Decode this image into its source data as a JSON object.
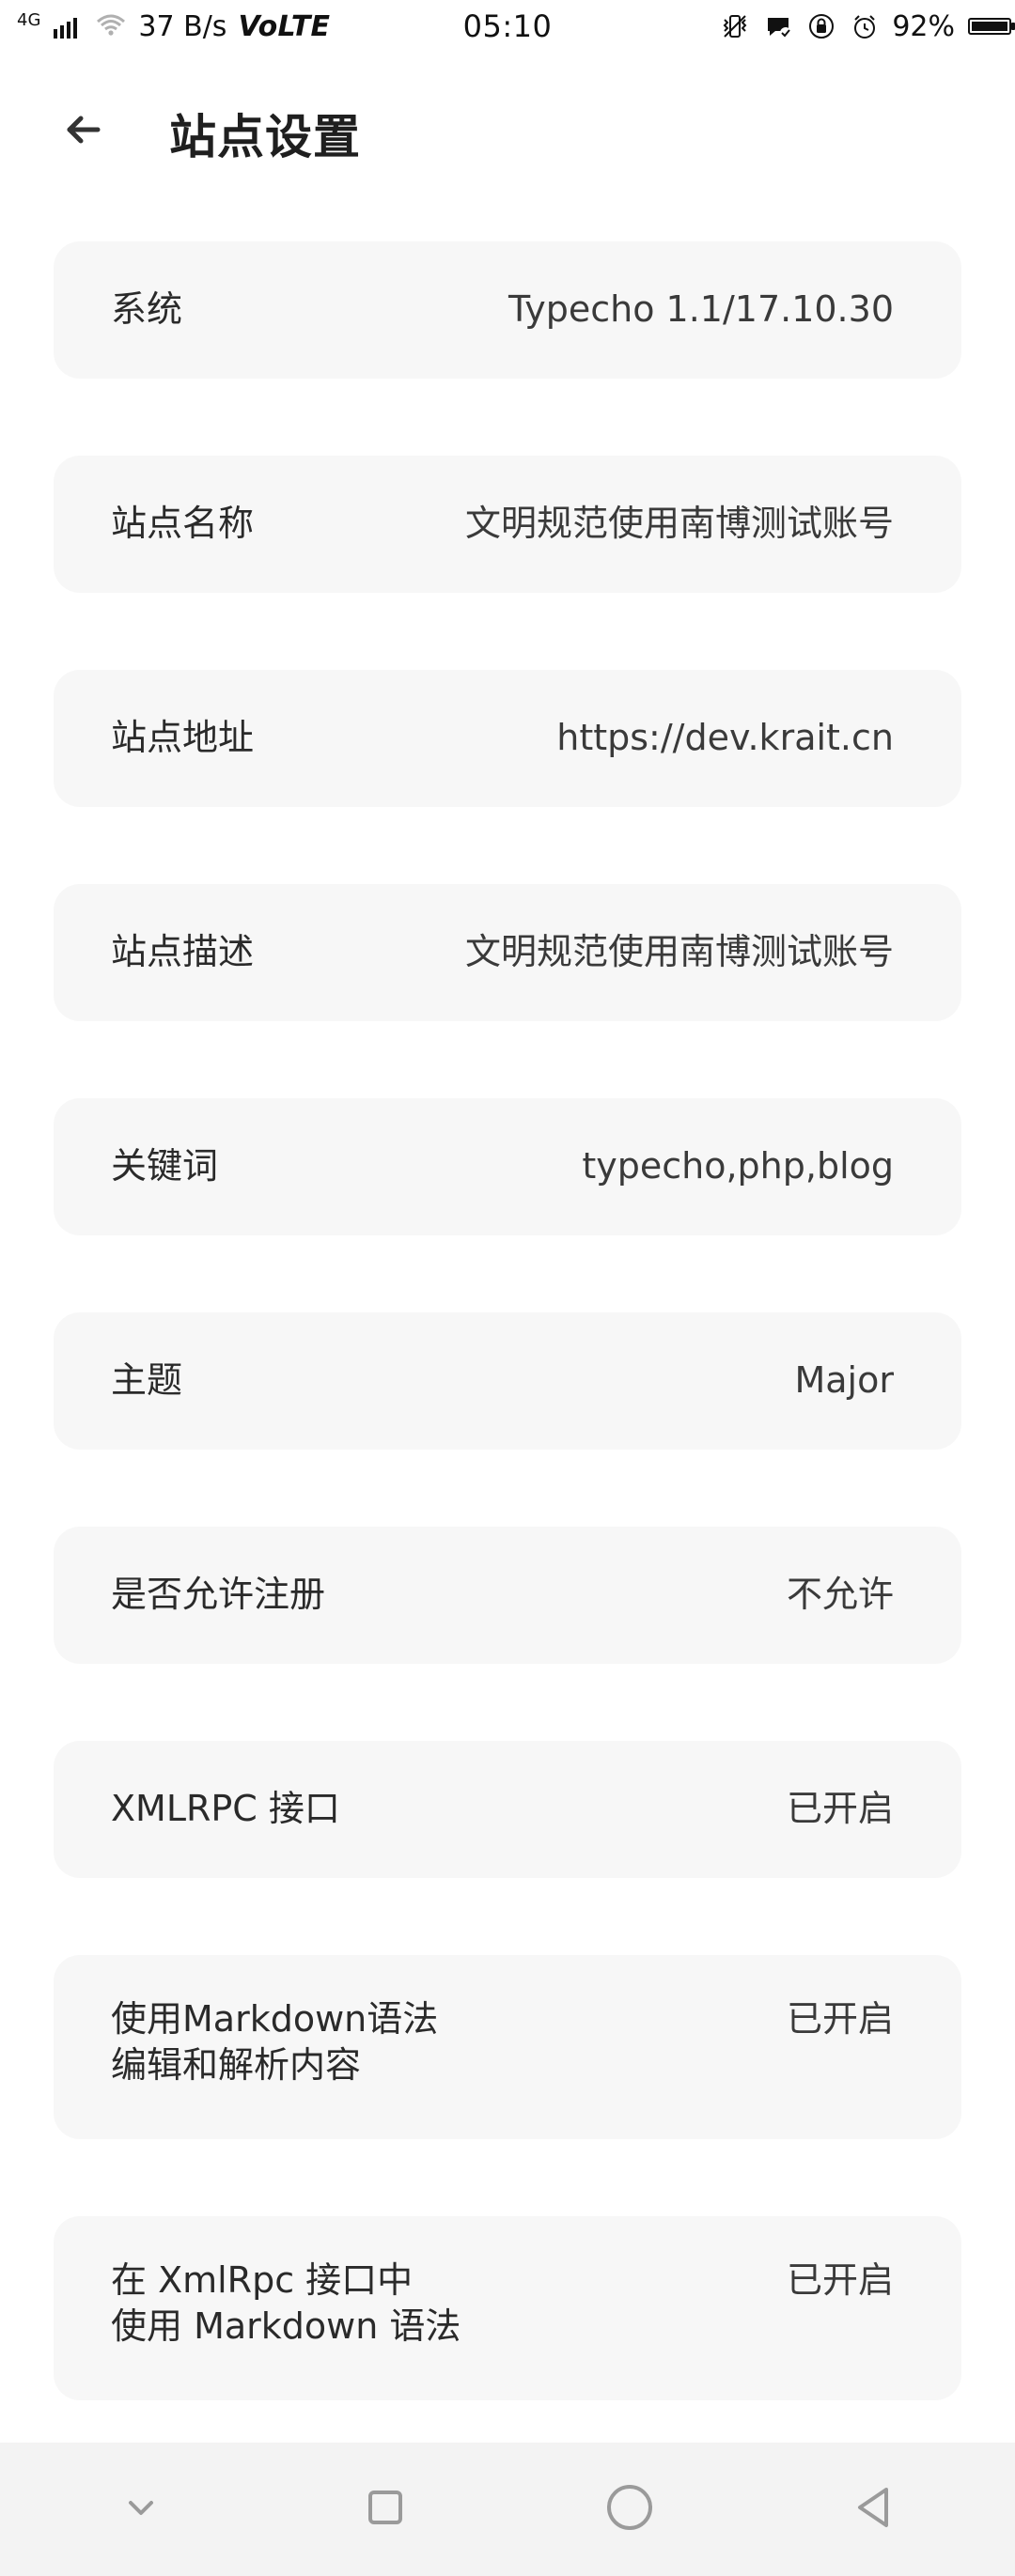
{
  "status_bar": {
    "network_gen": "4G",
    "speed": "37 B/s",
    "volte": "VoLTE",
    "time": "05:10",
    "battery": "92%"
  },
  "app_bar": {
    "title": "站点设置"
  },
  "settings": {
    "items": [
      {
        "label": "系统",
        "value": "Typecho 1.1/17.10.30"
      },
      {
        "label": "站点名称",
        "value": "文明规范使用南博测试账号"
      },
      {
        "label": "站点地址",
        "value": "https://dev.krait.cn"
      },
      {
        "label": "站点描述",
        "value": "文明规范使用南博测试账号"
      },
      {
        "label": "关键词",
        "value": "typecho,php,blog"
      },
      {
        "label": "主题",
        "value": "Major"
      },
      {
        "label": "是否允许注册",
        "value": "不允许"
      },
      {
        "label": "XMLRPC 接口",
        "value": "已开启"
      },
      {
        "label": "使用Markdown语法\n编辑和解析内容",
        "value": "已开启"
      },
      {
        "label": "在 XmlRpc 接口中\n使用 Markdown 语法",
        "value": "已开启"
      }
    ]
  },
  "icons": {
    "back": "arrow-left-icon",
    "nav_down": "chevron-down-icon",
    "nav_recent": "square-icon",
    "nav_home": "circle-icon",
    "nav_back": "triangle-back-icon"
  },
  "colors": {
    "card": "#f7f7f7",
    "navbar": "#f3f3f3",
    "text": "#222222"
  }
}
